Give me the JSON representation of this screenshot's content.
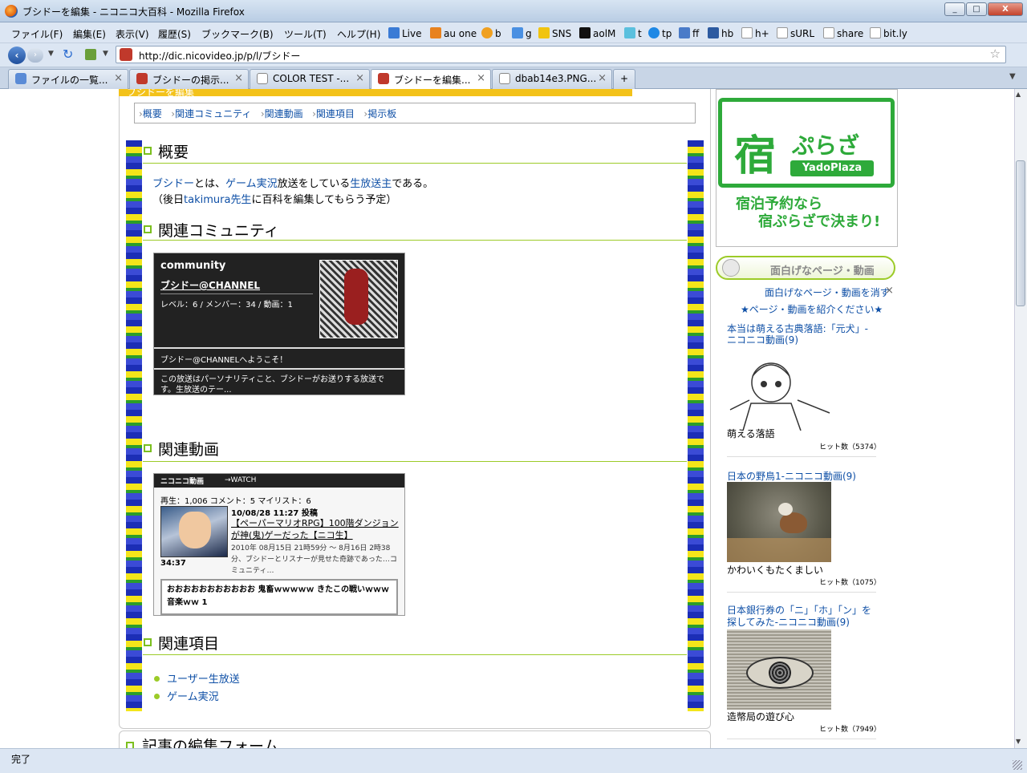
{
  "window": {
    "title": "ブシドーを編集 - ニコニコ大百科 - Mozilla Firefox",
    "min": "_",
    "max": "□",
    "close": "X"
  },
  "menu": [
    "ファイル(F)",
    "編集(E)",
    "表示(V)",
    "履歴(S)",
    "ブックマーク(B)",
    "ツール(T)",
    "ヘルプ(H)"
  ],
  "bookmarks": [
    "Live",
    "au one",
    "b",
    "g",
    "SNS",
    "aolM",
    "t",
    "tp",
    "ff",
    "hb",
    "h+",
    "sURL",
    "share",
    "bit.ly"
  ],
  "url": "http://dic.nicovideo.jp/p/l/ブシドー",
  "tabs": [
    "ファイルの一覧...",
    "ブシドーの掲示...",
    "COLOR TEST -...",
    "ブシドーを編集...",
    "dbab14e3.PNG..."
  ],
  "status": "完了",
  "header_partial": "ブシドーを編集",
  "toc": [
    "概要",
    "関連コミュニティ",
    "関連動画",
    "関連項目",
    "掲示板"
  ],
  "summary": {
    "heading": "概要",
    "line1_a": "ブシドー",
    "line1_b": "とは、",
    "line1_c": "ゲーム実況",
    "line1_d": "放送をしている",
    "line1_e": "生放送主",
    "line1_f": "である。",
    "line2_a": "（後日",
    "line2_b": "takimura先生",
    "line2_c": "に百科を編集してもらう予定）"
  },
  "community": {
    "heading": "関連コミュニティ",
    "logo": "community",
    "name": "ブシドー@CHANNEL",
    "stats": "レベル：6 / メンバー：34 / 動画：1",
    "welcome": "ブシドー@CHANNELへようこそ！",
    "desc": "この放送はパーソナリティこと、ブシドーがお送りする放送です。生放送のテー..."
  },
  "video": {
    "heading": "関連動画",
    "brand": "ニコニコ動画",
    "watch": "→WATCH",
    "stats": "再生：1,006 コメント：5 マイリスト：6",
    "date": "10/08/28 11:27 投稿",
    "title": "【ペーパーマリオRPG】100階ダンジョンが神(鬼)ゲーだった【ニコ生】",
    "desc": "2010年 08月15日 21時59分 〜 8月16日 2時38分、ブシドーとリスナーが見せた奇跡であった…コミュニティ…",
    "duration": "34:37",
    "comment": "おおおおおおおおおおお 鬼畜ｗｗｗｗｗ きたこの戦いｗｗｗ 音楽ｗｗ 1"
  },
  "related": {
    "heading": "関連項目",
    "items": [
      "ユーザー生放送",
      "ゲーム実況"
    ]
  },
  "edit_heading": "記事の編集フォーム",
  "ad": {
    "logo_kanji": "宿",
    "logo_kana": "ぷらざ",
    "logo_en": "YadoPlaza",
    "line1": "宿泊予約なら",
    "line2": "宿ぷらざで決まり!"
  },
  "sidebar": {
    "heading": "面白げなページ・動画",
    "hide": "面白げなページ・動画を消す",
    "intro": "★ページ・動画を紹介ください★",
    "entries": [
      {
        "title": "本当は萌える古典落語:「元犬」-ニコニコ動画(9)",
        "caption": "萌える落語",
        "hits": "ヒット数（5374）"
      },
      {
        "title": "日本の野鳥1-ニコニコ動画(9)",
        "caption": "かわいくもたくましい",
        "hits": "ヒット数（1075）"
      },
      {
        "title": "日本銀行券の「ニ」「ホ」「ン」を探してみた-ニコニコ動画(9)",
        "caption": "造幣局の遊び心",
        "hits": "ヒット数（7949）"
      }
    ]
  }
}
